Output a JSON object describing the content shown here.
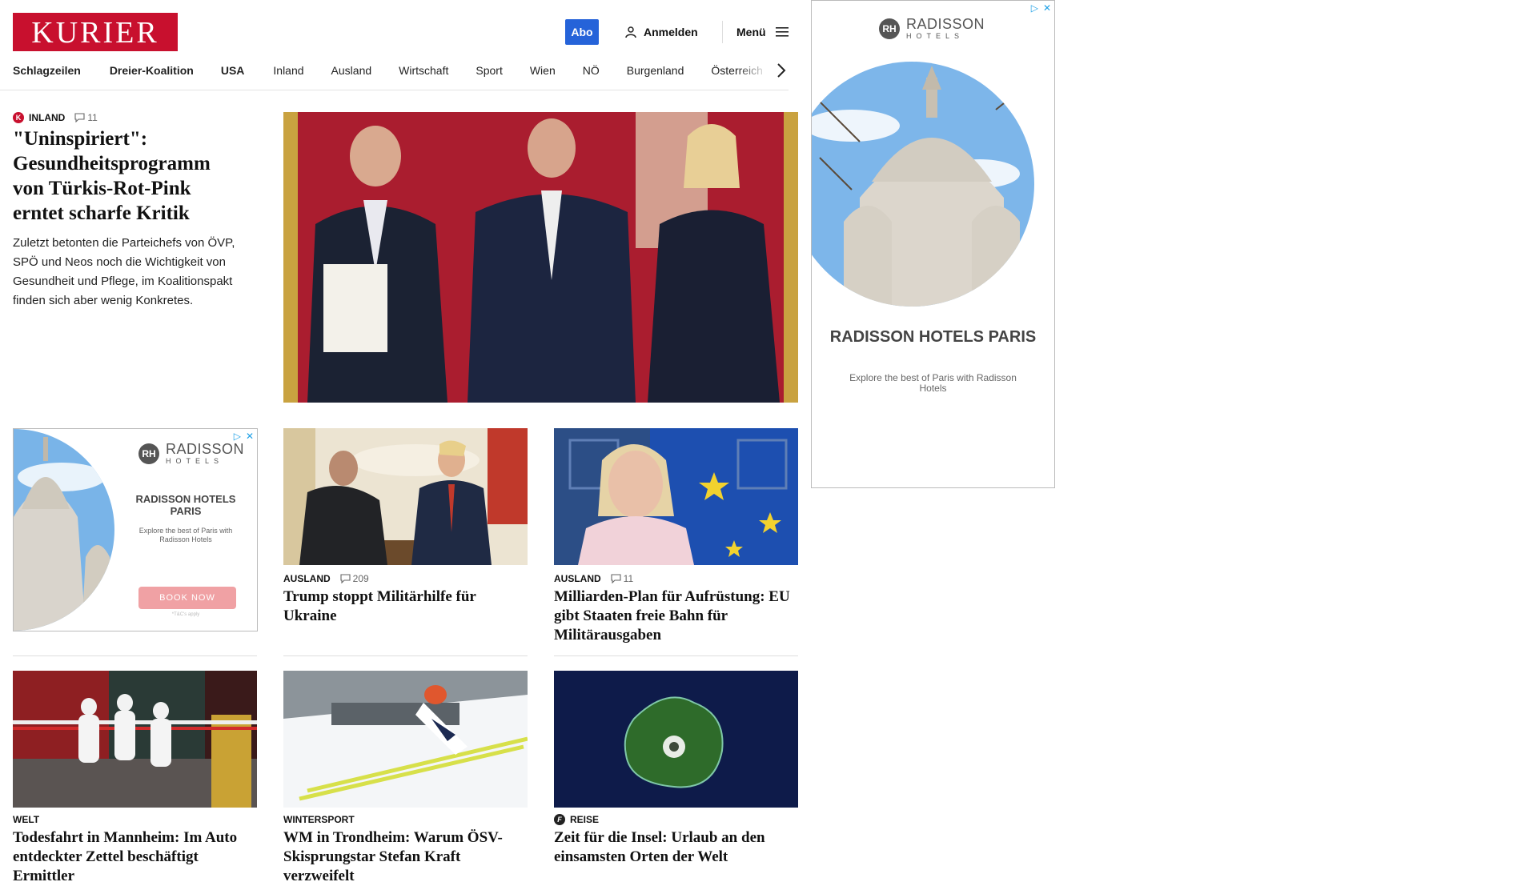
{
  "header": {
    "logo": "KURIER",
    "abo_label": "Abo",
    "login_label": "Anmelden",
    "menu_label": "Menü"
  },
  "nav": {
    "items": [
      "Schlagzeilen",
      "Dreier-Koalition",
      "USA",
      "Inland",
      "Ausland",
      "Wirtschaft",
      "Sport",
      "Wien",
      "NÖ",
      "Burgenland",
      "Österreich"
    ]
  },
  "lead": {
    "category": "INLAND",
    "badge": "K",
    "comments": "11",
    "title": "\"Uninspiriert\": Gesundheitsprogramm von Türkis-Rot-Pink erntet scharfe Kritik",
    "teaser": "Zuletzt betonten die Parteichefs von ÖVP, SPÖ und Neos noch die Wichtigkeit von Gesundheit und Pflege, im Koalitionspakt finden sich aber wenig Konkretes."
  },
  "cards": [
    {
      "category": "AUSLAND",
      "comments": "209",
      "title": "Trump stoppt Militärhilfe für Ukraine"
    },
    {
      "category": "AUSLAND",
      "comments": "11",
      "title": "Milliarden-Plan für Aufrüstung: EU gibt Staaten freie Bahn für Militärausgaben"
    },
    {
      "category": "WELT",
      "title": "Todesfahrt in Mannheim: Im Auto entdeckter Zettel beschäftigt Ermittler"
    },
    {
      "category": "WINTERSPORT",
      "title": "WM in Trondheim: Warum ÖSV-Skisprungstar Stefan Kraft verzweifelt"
    },
    {
      "category": "REISE",
      "badge": "f",
      "title": "Zeit für die Insel: Urlaub an den einsamsten Orten der Welt"
    }
  ],
  "ad_small": {
    "brand": "RADISSON",
    "brand_sub": "HOTELS",
    "title": "RADISSON HOTELS PARIS",
    "desc": "Explore the best of Paris with Radisson Hotels",
    "cta": "BOOK NOW",
    "fine": "*T&C's apply"
  },
  "ad_side": {
    "brand": "RADISSON",
    "brand_sub": "HOTELS",
    "title": "RADISSON HOTELS PARIS",
    "desc": "Explore the best of Paris with Radisson Hotels"
  },
  "colors": {
    "brand_red": "#c8102e",
    "abo_blue": "#2563d9",
    "ad_controls": "#1ea0e6",
    "ad_cta_pink": "#f0a1a4"
  }
}
